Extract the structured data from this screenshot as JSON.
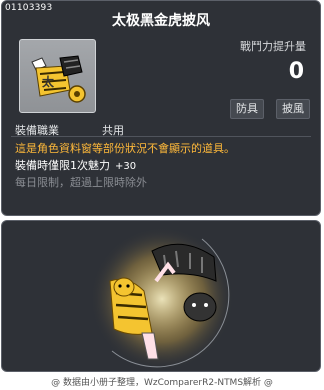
{
  "item": {
    "id": "01103393",
    "name": "太极黑金虎披风"
  },
  "stats": {
    "power_label": "戰鬥力提升量",
    "power_value": "0"
  },
  "tags": [
    "防具",
    "披風"
  ],
  "job": {
    "label": "裝備職業",
    "value": "共用"
  },
  "description": "這是角色資料窗等部份狀況不會顯示的道具。",
  "bonus": {
    "text": "裝備時僅限1次魅力",
    "value": "+30"
  },
  "limit_text": "每日限制，超過上限時除外",
  "footer": "@ 数据由小册子整理，WzComparerR2-NTMS解析 @",
  "colors": {
    "panel_bg": "#2e3137",
    "description": "#ffb93a",
    "limit": "#8a8d93",
    "text": "#ffffff"
  }
}
